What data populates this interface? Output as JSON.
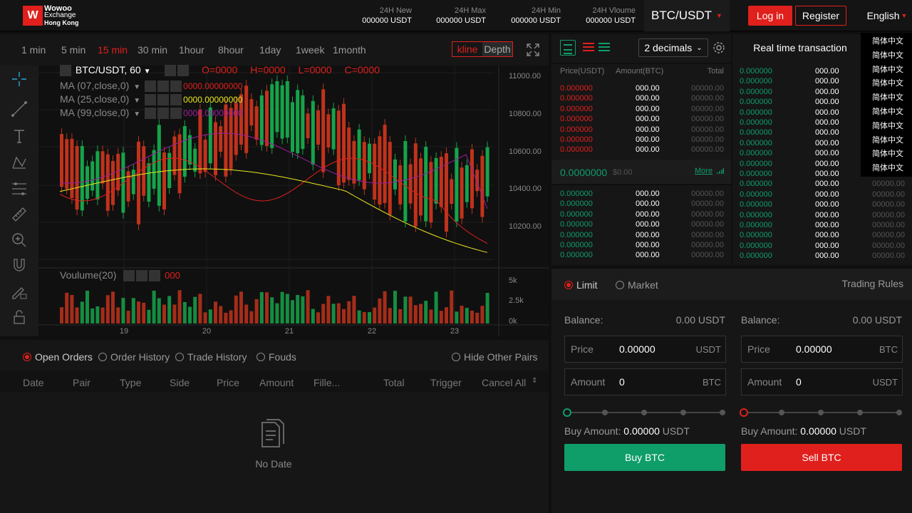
{
  "brand": {
    "name": "Wowoo",
    "line2": "Exchange",
    "line3": "Hong Kong"
  },
  "stats": [
    {
      "label": "24H New",
      "value": "000000 USDT"
    },
    {
      "label": "24H Max",
      "value": "000000 USDT"
    },
    {
      "label": "24H Min",
      "value": "000000 USDT"
    },
    {
      "label": "24H Vloume",
      "value": "000000 USDT"
    }
  ],
  "pair": "BTC/USDT",
  "auth": {
    "login": "Log in",
    "register": "Register"
  },
  "language": {
    "current": "English",
    "options": [
      "简体中文",
      "简体中文",
      "简体中文",
      "简体中文",
      "简体中文",
      "简体中文",
      "简体中文",
      "简体中文",
      "简体中文",
      "简体中文"
    ]
  },
  "timeframes": [
    "1 min",
    "5 min",
    "15 min",
    "30 min",
    "1hour",
    "8hour",
    "1day",
    "1week",
    "1month"
  ],
  "active_timeframe": "15 min",
  "chart_tabs": {
    "kline": "kline",
    "depth": "Depth"
  },
  "chart": {
    "symbol": "BTC/USDT,",
    "interval": "60",
    "ohlc": {
      "o": "O=0000",
      "h": "H=0000",
      "l": "L=0000",
      "c": "C=0000"
    },
    "ma": [
      {
        "label": "MA (07,close,0)",
        "value": "0000.00000000",
        "color": "#e0201c"
      },
      {
        "label": "MA (25,close,0)",
        "value": "0000.00000000",
        "color": "#e8e81c"
      },
      {
        "label": "MA (99,close,0)",
        "value": "0000.00000000",
        "color": "#a01ca0"
      }
    ],
    "price_ticks": [
      "11000.00",
      "10800.00",
      "10600.00",
      "10400.00",
      "10200.00"
    ],
    "volume": {
      "label": "Voulume(20)",
      "value": "000",
      "ticks": [
        "5k",
        "2.5k",
        "0k"
      ]
    },
    "date_ticks": [
      "19",
      "20",
      "21",
      "22",
      "23"
    ],
    "up_color": "#16a34a",
    "down_color": "#c0321c"
  },
  "order_tabs": [
    "Open Orders",
    "Order History",
    "Trade History",
    "Fouds"
  ],
  "hide_pairs": "Hide Other Pairs",
  "order_headers": [
    "Date",
    "Pair",
    "Type",
    "Side",
    "Price",
    "Amount",
    "Fille...",
    "Total",
    "Trigger",
    "Cancel All"
  ],
  "no_data": "No Date",
  "book": {
    "decimals": "2 decimals",
    "headers": {
      "price": "Price(USDT)",
      "amount": "Amount(BTC)",
      "total": "Total"
    },
    "asks": [
      {
        "p": "0.000000",
        "a": "000.00",
        "t": "00000.00"
      },
      {
        "p": "0.000000",
        "a": "000.00",
        "t": "00000.00"
      },
      {
        "p": "0.000000",
        "a": "000.00",
        "t": "00000.00"
      },
      {
        "p": "0.000000",
        "a": "000.00",
        "t": "00000.00"
      },
      {
        "p": "0.000000",
        "a": "000.00",
        "t": "00000.00"
      },
      {
        "p": "0.000000",
        "a": "000.00",
        "t": "00000.00"
      },
      {
        "p": "0.000000",
        "a": "000.00",
        "t": "00000.00"
      }
    ],
    "last_price": "0.0000000",
    "last_usd": "$0.00",
    "more": "More",
    "bids": [
      {
        "p": "0.000000",
        "a": "000.00",
        "t": "00000.00"
      },
      {
        "p": "0.000000",
        "a": "000.00",
        "t": "00000.00"
      },
      {
        "p": "0.000000",
        "a": "000.00",
        "t": "00000.00"
      },
      {
        "p": "0.000000",
        "a": "000.00",
        "t": "00000.00"
      },
      {
        "p": "0.000000",
        "a": "000.00",
        "t": "00000.00"
      },
      {
        "p": "0.000000",
        "a": "000.00",
        "t": "00000.00"
      },
      {
        "p": "0.000000",
        "a": "000.00",
        "t": "00000.00"
      }
    ]
  },
  "trades": {
    "title": "Real time transaction",
    "rows": [
      {
        "p": "0.000000",
        "a": "000.00",
        "t": "00000.00"
      },
      {
        "p": "0.000000",
        "a": "000.00",
        "t": "00000.00"
      },
      {
        "p": "0.000000",
        "a": "000.00",
        "t": "00000.00"
      },
      {
        "p": "0.000000",
        "a": "000.00",
        "t": "00000.00"
      },
      {
        "p": "0.000000",
        "a": "000.00",
        "t": "00000.00"
      },
      {
        "p": "0.000000",
        "a": "000.00",
        "t": "00000.00"
      },
      {
        "p": "0.000000",
        "a": "000.00",
        "t": "00000.00"
      },
      {
        "p": "0.000000",
        "a": "000.00",
        "t": "00000.00"
      },
      {
        "p": "0.000000",
        "a": "000.00",
        "t": "00000.00"
      },
      {
        "p": "0.000000",
        "a": "000.00",
        "t": "00000.00"
      },
      {
        "p": "0.000000",
        "a": "000.00",
        "t": "00000.00"
      },
      {
        "p": "0.000000",
        "a": "000.00",
        "t": "00000.00"
      },
      {
        "p": "0.000000",
        "a": "000.00",
        "t": "00000.00"
      },
      {
        "p": "0.000000",
        "a": "000.00",
        "t": "00000.00"
      },
      {
        "p": "0.000000",
        "a": "000.00",
        "t": "00000.00"
      },
      {
        "p": "0.000000",
        "a": "000.00",
        "t": "00000.00"
      },
      {
        "p": "0.000000",
        "a": "000.00",
        "t": "00000.00"
      },
      {
        "p": "0.000000",
        "a": "000.00",
        "t": "00000.00"
      },
      {
        "p": "0.000000",
        "a": "000.00",
        "t": "00000.00"
      }
    ]
  },
  "form": {
    "limit": "Limit",
    "market": "Market",
    "rules": "Trading Rules",
    "buy": {
      "balance_label": "Balance:",
      "balance": "0.00 USDT",
      "price_label": "Price",
      "price": "0.00000",
      "price_unit": "USDT",
      "amount_label": "Amount",
      "amount": "0",
      "amount_unit": "BTC",
      "buy_amount_label": "Buy Amount:",
      "buy_amount": "0.00000",
      "buy_amount_unit": "USDT",
      "button": "Buy BTC"
    },
    "sell": {
      "balance_label": "Balance:",
      "balance": "0.00 USDT",
      "price_label": "Price",
      "price": "0.00000",
      "price_unit": "BTC",
      "amount_label": "Amount",
      "amount": "0",
      "amount_unit": "USDT",
      "buy_amount_label": "Buy Amount:",
      "buy_amount": "0.00000",
      "buy_amount_unit": "USDT",
      "button": "Sell BTC"
    },
    "buy_color": "#0f9d6a",
    "sell_color": "#e0201c"
  }
}
